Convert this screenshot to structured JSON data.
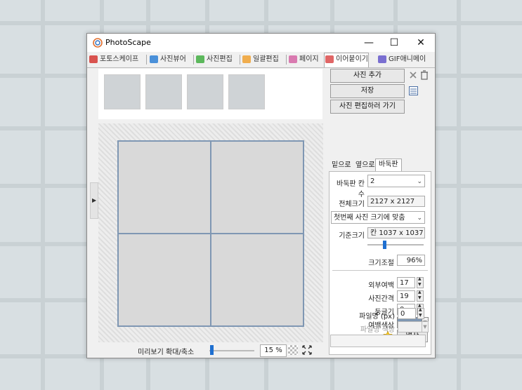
{
  "window": {
    "title": "PhotoScape",
    "minimize": "—",
    "maximize": "☐",
    "close": "✕"
  },
  "tabs": [
    {
      "label": "포토스케이프",
      "color": "#d9534f"
    },
    {
      "label": "사진뷰어",
      "color": "#4a90d9"
    },
    {
      "label": "사진편집",
      "color": "#5cb85c"
    },
    {
      "label": "일괄편집",
      "color": "#f0ad4e"
    },
    {
      "label": "페이지",
      "color": "#d97ab0"
    },
    {
      "label": "이어붙이기",
      "color": "#e06666"
    },
    {
      "label": "GIF애니메이",
      "color": "#7a6fd1"
    }
  ],
  "active_tab": "이어붙이기",
  "panel": {
    "add_photo": "사진 추가",
    "save": "저장",
    "go_edit": "사진 편집하러 가기",
    "subtabs": [
      "밑으로",
      "옆으로",
      "바둑판"
    ],
    "active_subtab": "바둑판",
    "grid_count_label": "바둑판 칸 수",
    "grid_count_value": "2",
    "total_size_label": "전체크기",
    "total_size_value": "2127 x 2127",
    "fit_mode": "첫번째 사진 크기에 맞춤",
    "base_size_label": "기준크기",
    "base_size_value": "칸 1037 x 1037",
    "scale_label": "크기조절",
    "scale_value": "96%",
    "outer_margin_label": "외부여백",
    "outer_margin_value": "17",
    "photo_gap_label": "사진간격",
    "photo_gap_value": "19",
    "round_label": "둥글기",
    "round_value": "0",
    "margin_color_label": "여백색상",
    "margin_color": "#7f97b3",
    "frame_button": "액자",
    "filename_label": "파일명 (px)",
    "filename_value": "0",
    "filename_color_label": "파일명 색상"
  },
  "preview": {
    "zoom_label": "미리보기 확대/축소",
    "zoom_value": "15 %",
    "zoom_level_percent": 15
  },
  "icons": {
    "app": "photoscape-icon",
    "remove": "remove-icon",
    "delete": "trash-icon",
    "list": "list-icon",
    "star": "star-icon",
    "fit": "fit-icon"
  }
}
